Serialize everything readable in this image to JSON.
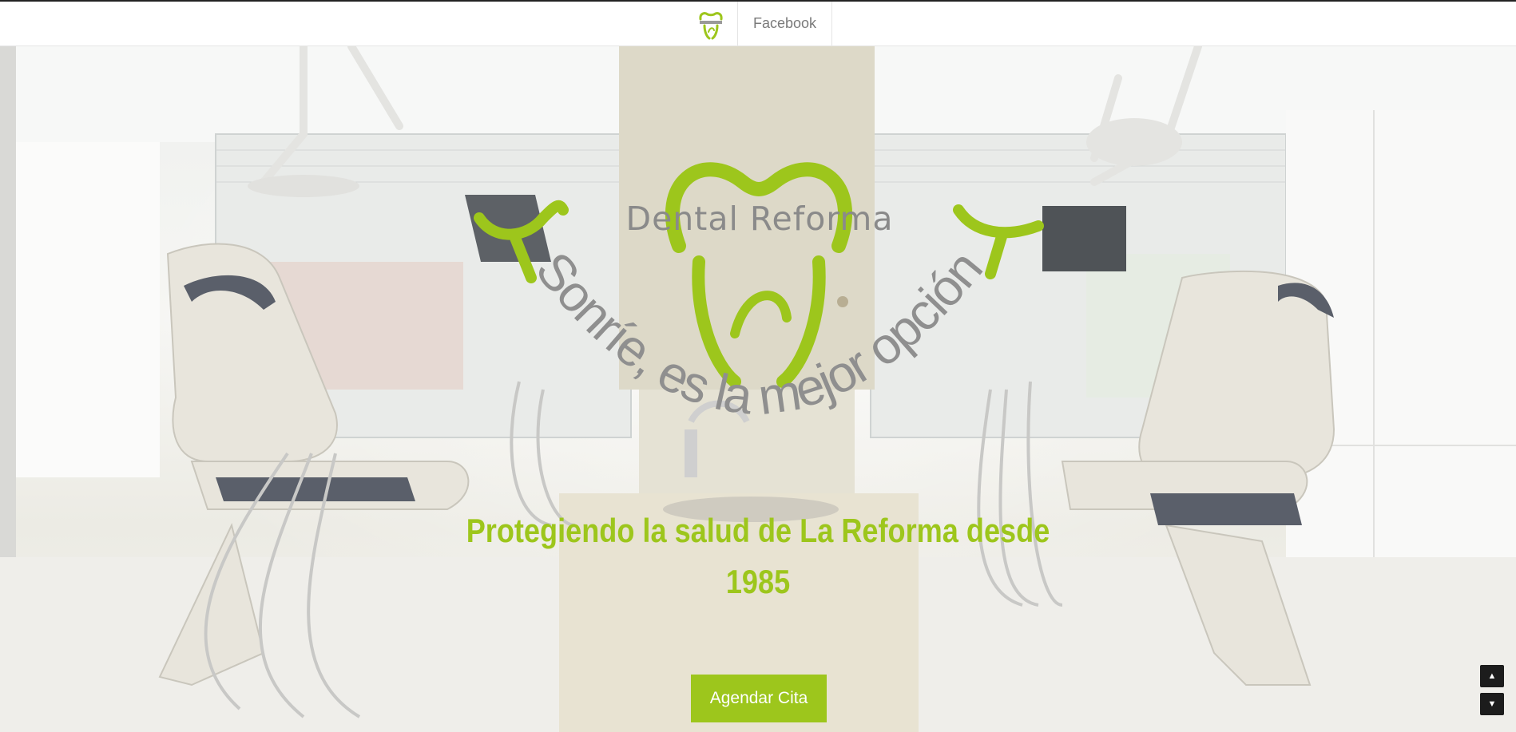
{
  "nav": {
    "logo_alt": "Dental Reforma",
    "facebook_label": "Facebook"
  },
  "hero": {
    "brand": "Dental Reforma",
    "tagline": "Sonríe, es la mejor opción",
    "headline_line1": "Protegiendo la salud de La Reforma desde",
    "headline_line2": "1985",
    "cta_label": "Agendar Cita"
  },
  "scroll": {
    "up_icon": "▲",
    "down_icon": "▼"
  },
  "colors": {
    "brand_green": "#9dc61c",
    "brand_gray": "#8a8a8a",
    "scroll_bg": "#1c1c1c"
  }
}
